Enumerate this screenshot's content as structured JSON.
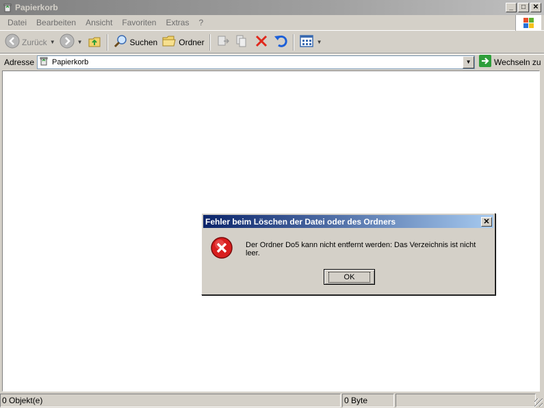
{
  "window": {
    "title": "Papierkorb",
    "min_label": "_",
    "max_label": "□",
    "close_label": "✕"
  },
  "menu": {
    "items": [
      "Datei",
      "Bearbeiten",
      "Ansicht",
      "Favoriten",
      "Extras",
      "?"
    ]
  },
  "toolbar": {
    "back_label": "Zurück",
    "search_label": "Suchen",
    "folders_label": "Ordner"
  },
  "address": {
    "label": "Adresse",
    "value": "Papierkorb",
    "go_label": "Wechseln zu"
  },
  "status": {
    "objects": "0 Objekt(e)",
    "size": "0 Byte"
  },
  "dialog": {
    "title": "Fehler beim Löschen der Datei oder des Ordners",
    "message": "Der Ordner Do5 kann nicht entfernt werden: Das Verzeichnis ist nicht leer.",
    "ok_label": "OK",
    "close_label": "✕"
  },
  "colors": {
    "dialog_title_start": "#0a246a",
    "dialog_title_end": "#a6caf0",
    "error_icon": "#d81e1e",
    "delete_icon": "#e0281c",
    "undo_icon": "#1c5fd8",
    "go_icon": "#2e9e3a"
  }
}
